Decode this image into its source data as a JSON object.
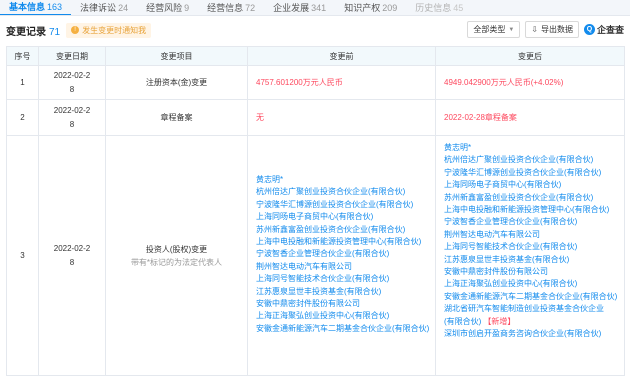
{
  "tabs": [
    {
      "label": "基本信息",
      "count": "163",
      "state": "active"
    },
    {
      "label": "法律诉讼",
      "count": "24",
      "state": "normal"
    },
    {
      "label": "经营风险",
      "count": "9",
      "state": "normal"
    },
    {
      "label": "经营信息",
      "count": "72",
      "state": "normal"
    },
    {
      "label": "企业发展",
      "count": "341",
      "state": "normal"
    },
    {
      "label": "知识产权",
      "count": "209",
      "state": "normal"
    },
    {
      "label": "历史信息",
      "count": "45",
      "state": "faded"
    }
  ],
  "header": {
    "title": "变更记录",
    "count": "71",
    "notice": "发生变更时通知我",
    "filter_label": "全部类型",
    "export_label": "导出数据",
    "brand": "企查查"
  },
  "table": {
    "columns": [
      "序号",
      "变更日期",
      "变更项目",
      "变更前",
      "变更后"
    ],
    "rows": [
      {
        "no": "1",
        "date_line1": "2022-02-2",
        "date_line2": "8",
        "item": "注册资本(金)变更",
        "before": "4757.601200万元人民币",
        "after": "4949.042900万元人民币(+4.02%)"
      },
      {
        "no": "2",
        "date_line1": "2022-02-2",
        "date_line2": "8",
        "item": "章程备案",
        "before": "无",
        "after": "2022-02-28章程备案"
      },
      {
        "no": "3",
        "date_line1": "2022-02-2",
        "date_line2": "8",
        "item": "投资人(股权)变更",
        "item_sub": "带有*标记的为法定代表人",
        "before": [
          "黄志明*",
          "杭州倍达广聚创业投资合伙企业(有限合伙)",
          "宁波隆华汇博源创业投资合伙企业(有限合伙)",
          "上海同旸电子商贸中心(有限合伙)",
          "苏州新鑫富盈创业投资合伙企业(有限合伙)",
          "上海中电投融和新能源投资管理中心(有限合伙)",
          "宁波智香企业管理合伙企业(有限合伙)",
          "荆州智达电动汽车有限公司",
          "上海同号智能技术合伙企业(有限合伙)",
          "江苏惠泉显世丰投资基金(有限合伙)",
          "安徽中鼎密封件股份有限公司",
          "上海正海聚弘创业投资中心(有限合伙)",
          "安徽金通新能源汽车二期基金合伙企业(有限合伙)"
        ],
        "after": [
          "黄志明*",
          "杭州倍达广聚创业投资合伙企业(有限合伙)",
          "宁波隆华汇博源创业投资合伙企业(有限合伙)",
          "上海同旸电子商贸中心(有限合伙)",
          "苏州新鑫富盈创业投资合伙企业(有限合伙)",
          "上海中电投融和新能源投资管理中心(有限合伙)",
          "宁波智香企业管理合伙企业(有限合伙)",
          "荆州智达电动汽车有限公司",
          "上海同号智能技术合伙企业(有限合伙)",
          "江苏惠泉显世丰投资基金(有限合伙)",
          "安徽中鼎密封件股份有限公司",
          "上海正海聚弘创业投资中心(有限合伙)",
          "安徽金通新能源汽车二期基金合伙企业(有限合伙)",
          "湖北省研汽车智能制造创业投资基金合伙企业",
          "(有限合伙)",
          "深圳市创启开盈商务咨询合伙企业(有限合伙)"
        ],
        "after_new_tag": "【新增】"
      }
    ]
  },
  "colors": {
    "accent": "#128bed",
    "red": "#fd485e",
    "header_bg": "#f2f9fc"
  },
  "icons": [
    "bell-icon",
    "export-icon",
    "qichacha-logo-icon",
    "chevron-down-icon"
  ]
}
